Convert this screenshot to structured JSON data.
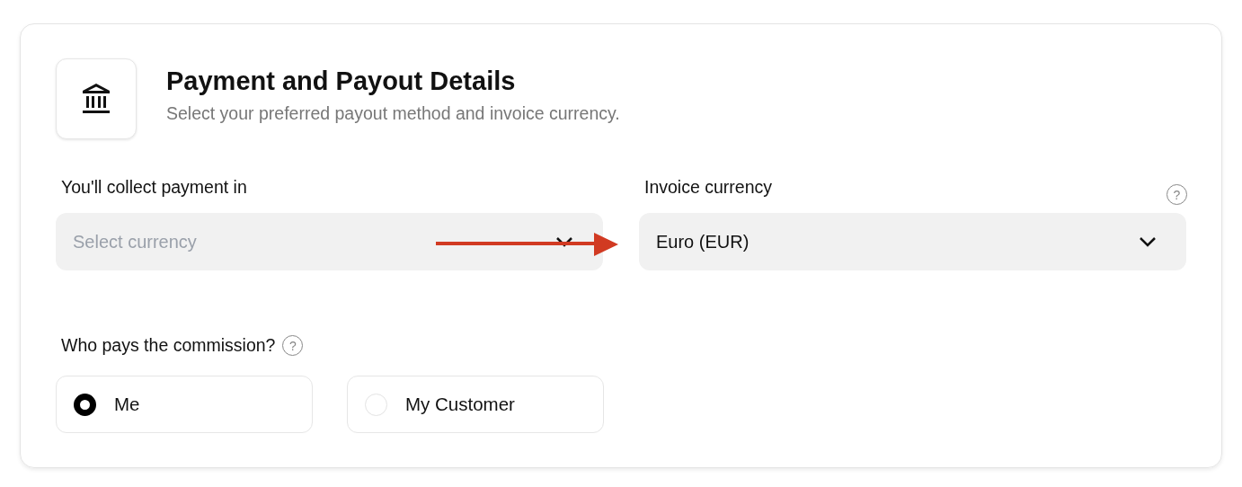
{
  "header": {
    "title": "Payment and Payout Details",
    "subtitle": "Select your preferred payout method and invoice currency."
  },
  "fields": [
    {
      "label": "You'll collect payment in",
      "placeholder": "Select currency"
    },
    {
      "label": "Invoice currency",
      "value": "Euro (EUR)",
      "help": "?"
    }
  ],
  "commission": {
    "label": "Who pays the commission?",
    "help": "?",
    "options": [
      {
        "label": "Me",
        "selected": true
      },
      {
        "label": "My Customer",
        "selected": false
      }
    ]
  },
  "annotation": {
    "kind": "arrow"
  }
}
